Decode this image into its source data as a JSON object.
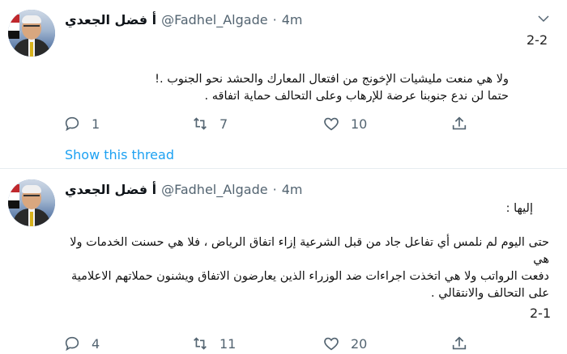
{
  "tweets": [
    {
      "name": "أ فضل الجعدي",
      "handle": "@Fadhel_Algade",
      "dot": "·",
      "time": "4m",
      "thread_index": "2-2",
      "lines": [
        "ولا هي منعت مليشيات الإخونج من افتعال المعارك والحشد نحو الجنوب .!",
        "حتما لن ندع جنوبنا عرضة للإرهاب وعلى التحالف حماية اتفاقه ."
      ],
      "replies": "1",
      "retweets": "7",
      "likes": "10",
      "show_thread": "Show this thread"
    },
    {
      "name": "أ فضل الجعدي",
      "handle": "@Fadhel_Algade",
      "dot": "·",
      "time": "4m",
      "intro": "إليها :",
      "lines": [
        "حتى اليوم لم نلمس أي تفاعل جاد من قبل الشرعية إزاء اتفاق الرياض ، فلا هي حسنت الخدمات ولا هي",
        "دفعت الرواتب ولا هي اتخذت اجراءات ضد الوزراء الذين يعارضون الاتفاق ويشنون حملاتهم الاعلامية",
        "على التحالف والانتقالي ."
      ],
      "thread_index": "2-1",
      "replies": "4",
      "retweets": "11",
      "likes": "20"
    }
  ],
  "icons": {
    "reply": "reply-icon",
    "retweet": "retweet-icon",
    "like": "heart-icon",
    "share": "share-icon",
    "more": "chevron-down-icon"
  },
  "colors": {
    "link": "#1da1f2",
    "muted": "#536471",
    "separator": "#e6ecf0"
  }
}
